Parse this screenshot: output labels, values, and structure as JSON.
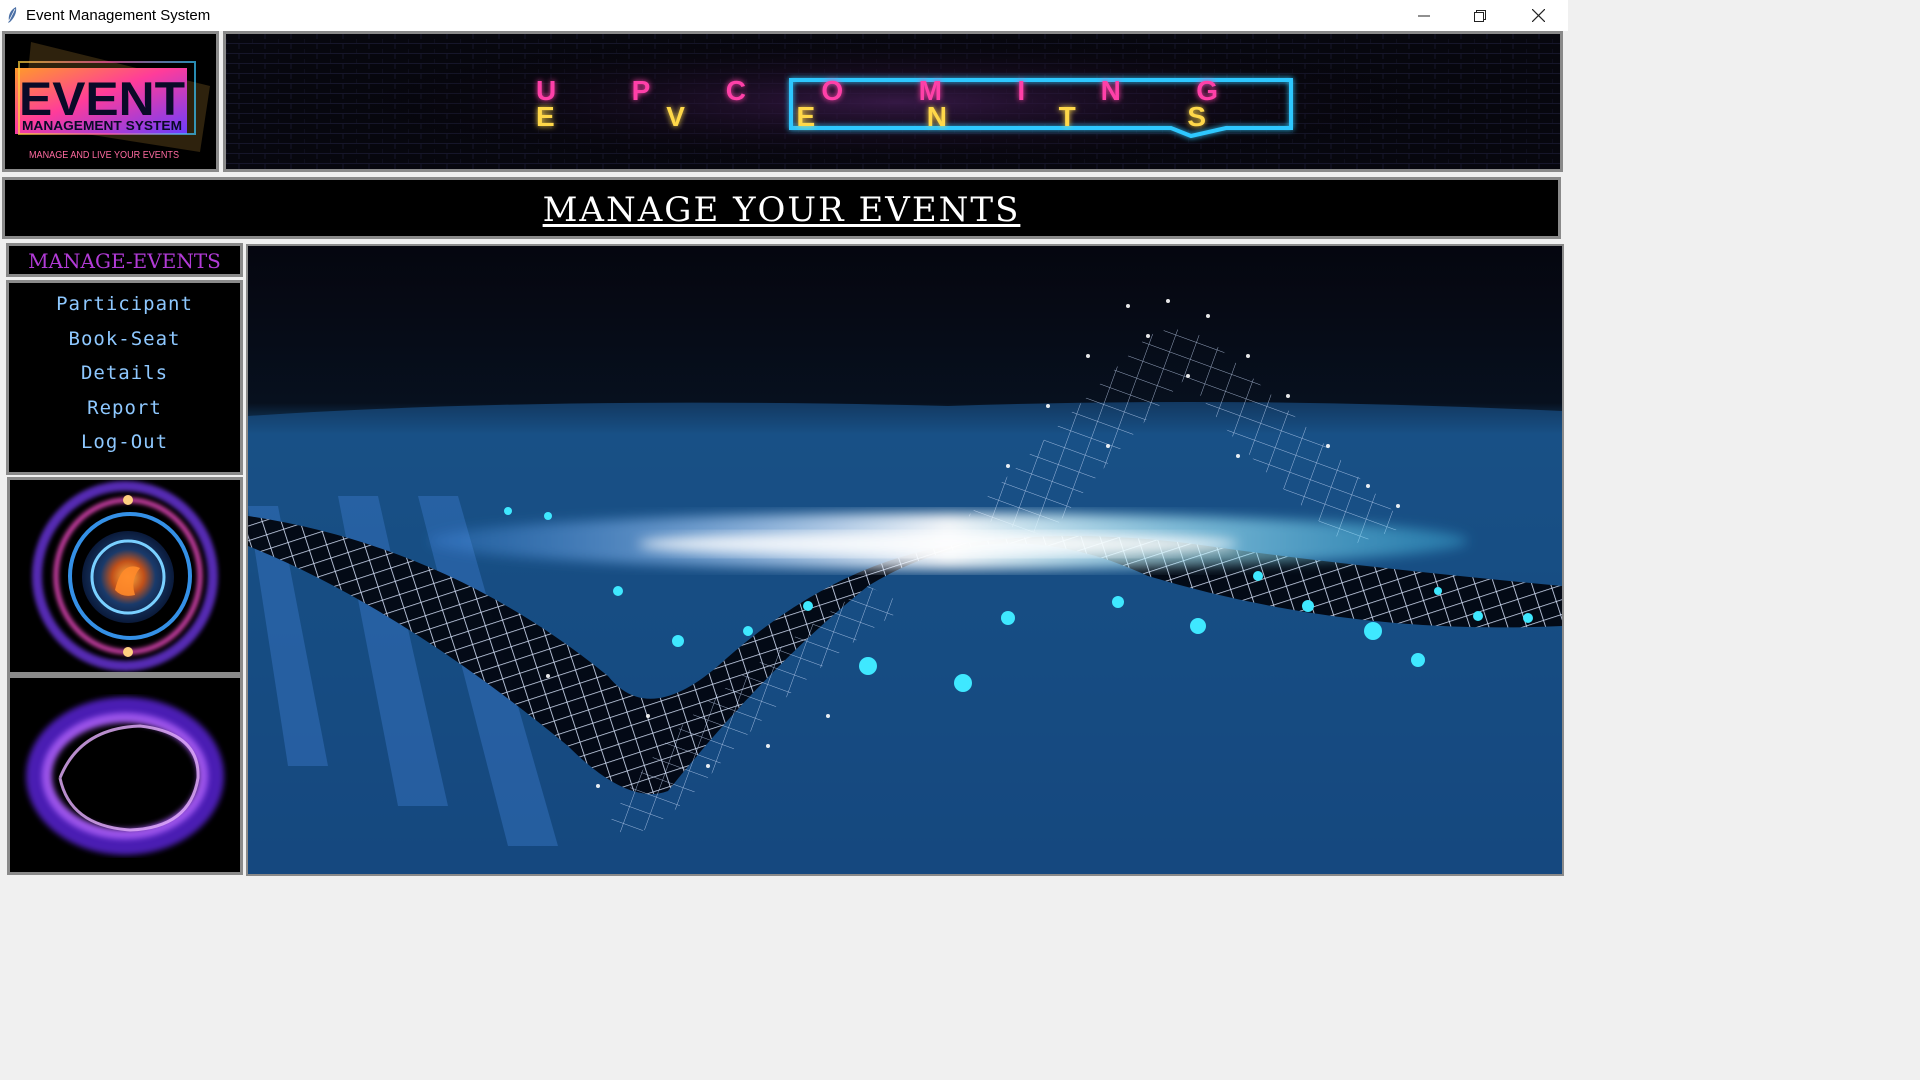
{
  "window": {
    "title": "Event Management System",
    "controls": {
      "minimize": "minimize-icon",
      "restore": "restore-icon",
      "close": "close-icon"
    }
  },
  "logo": {
    "line1": "EVENT",
    "line2": "MANAGEMENT SYSTEM",
    "tagline": "MANAGE AND LIVE YOUR EVENTS"
  },
  "banner": {
    "line1": "UPCOMING",
    "line2": "EVENTS"
  },
  "header": {
    "title": "MANAGE YOUR EVENTS"
  },
  "sidebar": {
    "title": "MANAGE-EVENTS",
    "items": [
      {
        "label": "Participant"
      },
      {
        "label": "Book-Seat"
      },
      {
        "label": "Details"
      },
      {
        "label": "Report"
      },
      {
        "label": "Log-Out"
      }
    ]
  },
  "colors": {
    "menu_title": "#b23bd6",
    "menu_items": "#8ec8ff",
    "frame_border": "#8a8a8a",
    "banner_pink": "#ff3fa8",
    "banner_yellow": "#ffd84a",
    "banner_cyan": "#2fc8ff"
  }
}
